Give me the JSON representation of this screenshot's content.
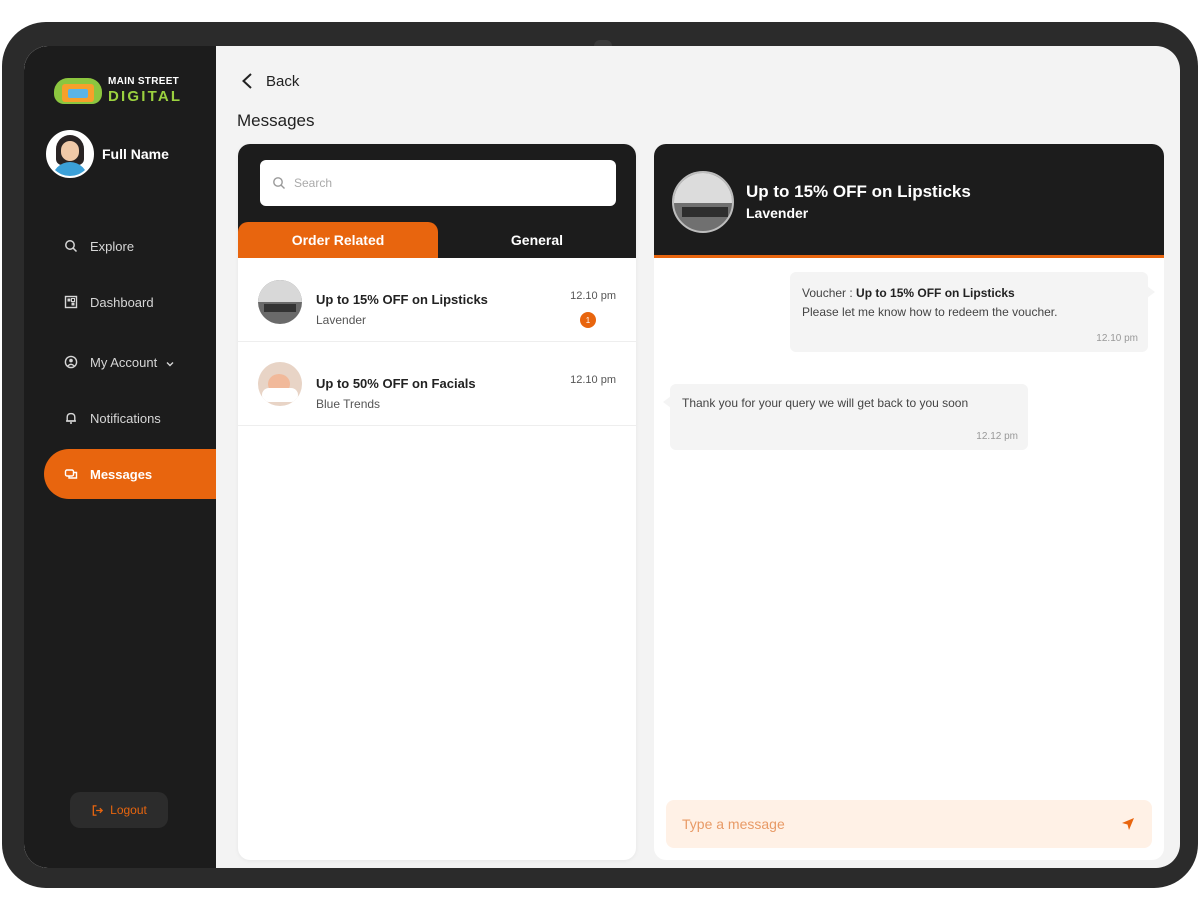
{
  "brand": {
    "line1": "MAIN STREET",
    "line2": "DIGITAL"
  },
  "profile": {
    "name": "Full Name"
  },
  "nav": {
    "items": [
      {
        "label": "Explore",
        "icon": "search-icon"
      },
      {
        "label": "Dashboard",
        "icon": "dashboard-icon"
      },
      {
        "label": "My Account",
        "icon": "account-icon"
      },
      {
        "label": "Notifications",
        "icon": "bell-icon"
      },
      {
        "label": "Messages",
        "icon": "messages-icon",
        "active": true
      }
    ],
    "logout": "Logout"
  },
  "header": {
    "back": "Back",
    "title": "Messages"
  },
  "list": {
    "search_placeholder": "Search",
    "tabs": [
      {
        "label": "Order Related",
        "active": true
      },
      {
        "label": "General",
        "active": false
      }
    ],
    "conversations": [
      {
        "title": "Up to 15% OFF on Lipsticks",
        "subtitle": "Lavender",
        "time": "12.10 pm",
        "unread": "1"
      },
      {
        "title": "Up to 50% OFF on Facials",
        "subtitle": "Blue Trends",
        "time": "12.10 pm"
      }
    ]
  },
  "chat": {
    "title": "Up to 15% OFF on Lipsticks",
    "subtitle": "Lavender",
    "messages": [
      {
        "direction": "out",
        "prefix": "Voucher : ",
        "highlight": "Up to 15% OFF on Lipsticks",
        "text": "Please let me know how to redeem the voucher.",
        "time": "12.10 pm"
      },
      {
        "direction": "in",
        "text": "Thank you for your query we will get back to you soon",
        "time": "12.12 pm"
      }
    ],
    "composer_placeholder": "Type a message"
  },
  "colors": {
    "accent": "#e8650e",
    "dark": "#1c1c1c",
    "brand_green": "#9bd13f"
  }
}
